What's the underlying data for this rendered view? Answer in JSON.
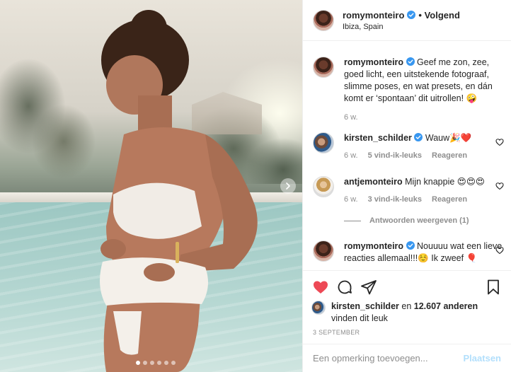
{
  "post": {
    "author": "romymonteiro",
    "follow_status": "• Volgend",
    "location": "Ibiza, Spain",
    "image_count": 6,
    "active_image": 1
  },
  "caption": {
    "username": "romymonteiro",
    "text": "Geef me zon, zee, goed licht, een uitstekende fotograaf, slimme poses, en wat presets, en dán komt er ‘spontaan’ dit uitrollen! 🤪",
    "time": "6 w."
  },
  "comments": [
    {
      "username": "kirsten_schilder",
      "text": "Wauw🎉❤️",
      "time": "6 w.",
      "likes": "5 vind-ik-leuks",
      "reply": "Reageren"
    },
    {
      "username": "antjemonteiro",
      "text": "Mijn knappie 😍😍😍",
      "time": "6 w.",
      "likes": "3 vind-ik-leuks",
      "reply": "Reageren"
    },
    {
      "username": "romymonteiro",
      "text": "Nouuuu wat een lieve reacties allemaal!!!☺️ Ik zweef 🎈"
    }
  ],
  "view_replies": "Antwoorden weergeven (1)",
  "likes_summary": {
    "user": "kirsten_schilder",
    "connector": "en",
    "others": "12.607 anderen",
    "suffix": "vinden dit leuk"
  },
  "date": "3 SEPTEMBER",
  "add_comment": {
    "placeholder": "Een opmerking toevoegen...",
    "submit": "Plaatsen"
  },
  "colors": {
    "like_red": "#ed4956",
    "verified_blue": "#3897f0",
    "submit_disabled": "#b2dffc",
    "muted": "#8e8e8e"
  },
  "icons": [
    "next-arrow-icon",
    "verified-badge-icon",
    "heart-icon",
    "comment-icon",
    "share-icon",
    "bookmark-icon"
  ]
}
